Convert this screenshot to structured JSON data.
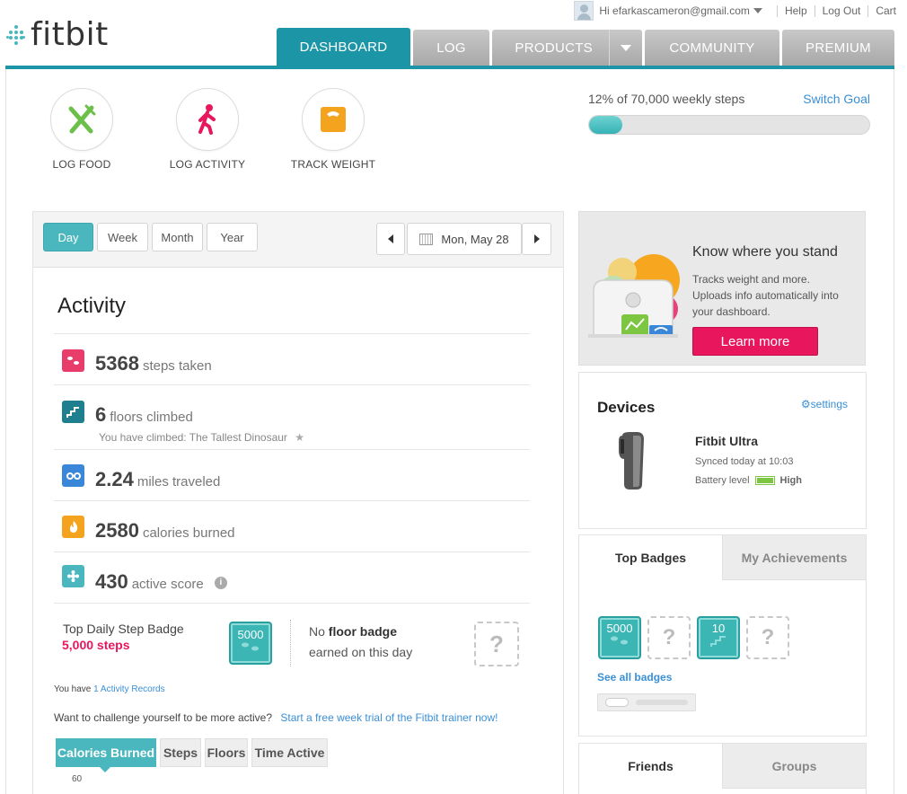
{
  "brand": {
    "logo_text": "fitbit",
    "accent": "#1c95a7",
    "teal": "#4ab7bf",
    "pink": "#e8175d"
  },
  "userbar": {
    "greeting": "Hi efarkascameron@gmail.com",
    "links": [
      "Help",
      "Log Out",
      "Cart"
    ]
  },
  "nav": {
    "tabs": [
      "DASHBOARD",
      "LOG",
      "PRODUCTS",
      "COMMUNITY",
      "PREMIUM"
    ],
    "active": "DASHBOARD"
  },
  "quick_actions": [
    {
      "label": "LOG FOOD",
      "icon": "fork-knife-icon"
    },
    {
      "label": "LOG ACTIVITY",
      "icon": "walking-person-icon"
    },
    {
      "label": "TRACK WEIGHT",
      "icon": "scale-icon"
    }
  ],
  "goal": {
    "text": "12% of 70,000 weekly steps",
    "switch_label": "Switch Goal",
    "progress_percent": 12
  },
  "range_tabs": [
    "Day",
    "Week",
    "Month",
    "Year"
  ],
  "date": {
    "label": "Mon, May 28"
  },
  "activity": {
    "title": "Activity",
    "steps": {
      "value": "5368",
      "unit": "steps taken",
      "color": "#e83c6b"
    },
    "floors": {
      "value": "6",
      "unit": "floors climbed",
      "sub": "You have climbed: The Tallest Dinosaur",
      "color": "#1f7f8f"
    },
    "distance": {
      "value": "2.24",
      "unit": "miles traveled",
      "color": "#3a86d9"
    },
    "calories": {
      "value": "2580",
      "unit": "calories burned",
      "color": "#f4a31f"
    },
    "score": {
      "value": "430",
      "unit": "active score",
      "color": "#4ab7bf"
    }
  },
  "badges_day": {
    "step_title": "Top Daily Step Badge",
    "step_value": "5,000 steps",
    "step_badge_label": "5000",
    "floor_prefix": "No",
    "floor_bold": "floor badge",
    "floor_suffix": "earned on this day",
    "empty_mark": "?"
  },
  "records": {
    "prefix": "You have",
    "link": "1 Activity Records"
  },
  "challenge": {
    "text": "Want to challenge yourself to be more active?",
    "link": "Start a free week trial of the Fitbit trainer now!"
  },
  "chart_tabs": [
    "Calories Burned",
    "Steps",
    "Floors",
    "Time Active"
  ],
  "chart_axis_label": "60",
  "promo": {
    "title": "Know where you stand",
    "body": "Tracks weight and more. Uploads info automatically into your dashboard.",
    "button": "Learn more"
  },
  "devices": {
    "title": "Devices",
    "settings": "settings",
    "device_name": "Fitbit Ultra",
    "synced": "Synced today at 10:03",
    "battery_label": "Battery level",
    "battery_value": "High"
  },
  "badges_card": {
    "tabs": [
      "Top Badges",
      "My Achievements"
    ],
    "items": [
      "5000",
      "?",
      "10",
      "?"
    ],
    "see_all": "See all badges"
  },
  "social_tabs": [
    "Friends",
    "Groups"
  ]
}
